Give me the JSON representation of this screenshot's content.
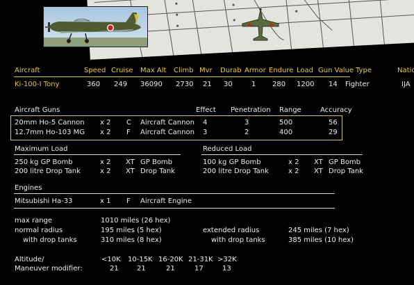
{
  "summary": {
    "headers": [
      "Aircraft",
      "Speed",
      "Cruise",
      "Max Alt",
      "Climb",
      "Mvr",
      "Durab",
      "Armor",
      "Endure",
      "Load",
      "Gun Value",
      "Type",
      "Nation"
    ],
    "row": [
      "Ki-100-I Tony",
      "360",
      "249",
      "36090",
      "2730",
      "21",
      "30",
      "1",
      "280",
      "1200",
      "14",
      "Fighter",
      "IJA"
    ]
  },
  "guns": {
    "title": "Aircraft Guns",
    "headers": [
      "Effect",
      "Penetration",
      "Range",
      "Accuracy"
    ],
    "rows": [
      [
        "20mm Ho-5 Cannon",
        "x 2",
        "C",
        "Aircraft Cannon",
        "4",
        "3",
        "500",
        "56"
      ],
      [
        "12.7mm Ho-103 MG",
        "x 2",
        "F",
        "Aircraft Cannon",
        "3",
        "2",
        "400",
        "29"
      ]
    ]
  },
  "load": {
    "max_title": "Maximum Load",
    "reduced_title": "Reduced Load",
    "max_rows": [
      [
        "250 kg GP Bomb",
        "x 2",
        "XT",
        "GP Bomb"
      ],
      [
        "200 litre Drop Tank",
        "x 2",
        "XT",
        "Drop Tank"
      ]
    ],
    "reduced_rows": [
      [
        "100 kg GP Bomb",
        "x 2",
        "XT",
        "GP Bomb"
      ],
      [
        "200 litre Drop Tank",
        "x 2",
        "XT",
        "Drop Tank"
      ]
    ]
  },
  "engines": {
    "title": "Engines",
    "row": [
      "Mitsubishi Ha-33",
      "x 1",
      "F",
      "Aircraft Engine"
    ]
  },
  "range": {
    "max_range_label": "max range",
    "max_range_value": "1010 miles (26 hex)",
    "normal_label": "normal radius",
    "normal_value": "195 miles (5 hex)",
    "normal_dt_label": "with drop tanks",
    "normal_dt_value": "310 miles (8 hex)",
    "extended_label": "extended radius",
    "extended_value": "245 miles (7 hex)",
    "extended_dt_label": "with drop tanks",
    "extended_dt_value": "385 miles (10 hex)"
  },
  "maneuver": {
    "altitude_label": "Altitude/",
    "modifier_label": "Maneuver modifier:",
    "bands": [
      "<10K",
      "10-15K",
      "16-20K",
      "21-31K",
      ">32K"
    ],
    "values": [
      "21",
      "21",
      "21",
      "17",
      "13"
    ]
  },
  "colors": {
    "accent": "#e7c84d",
    "text": "#ededed",
    "background": "#000000"
  }
}
